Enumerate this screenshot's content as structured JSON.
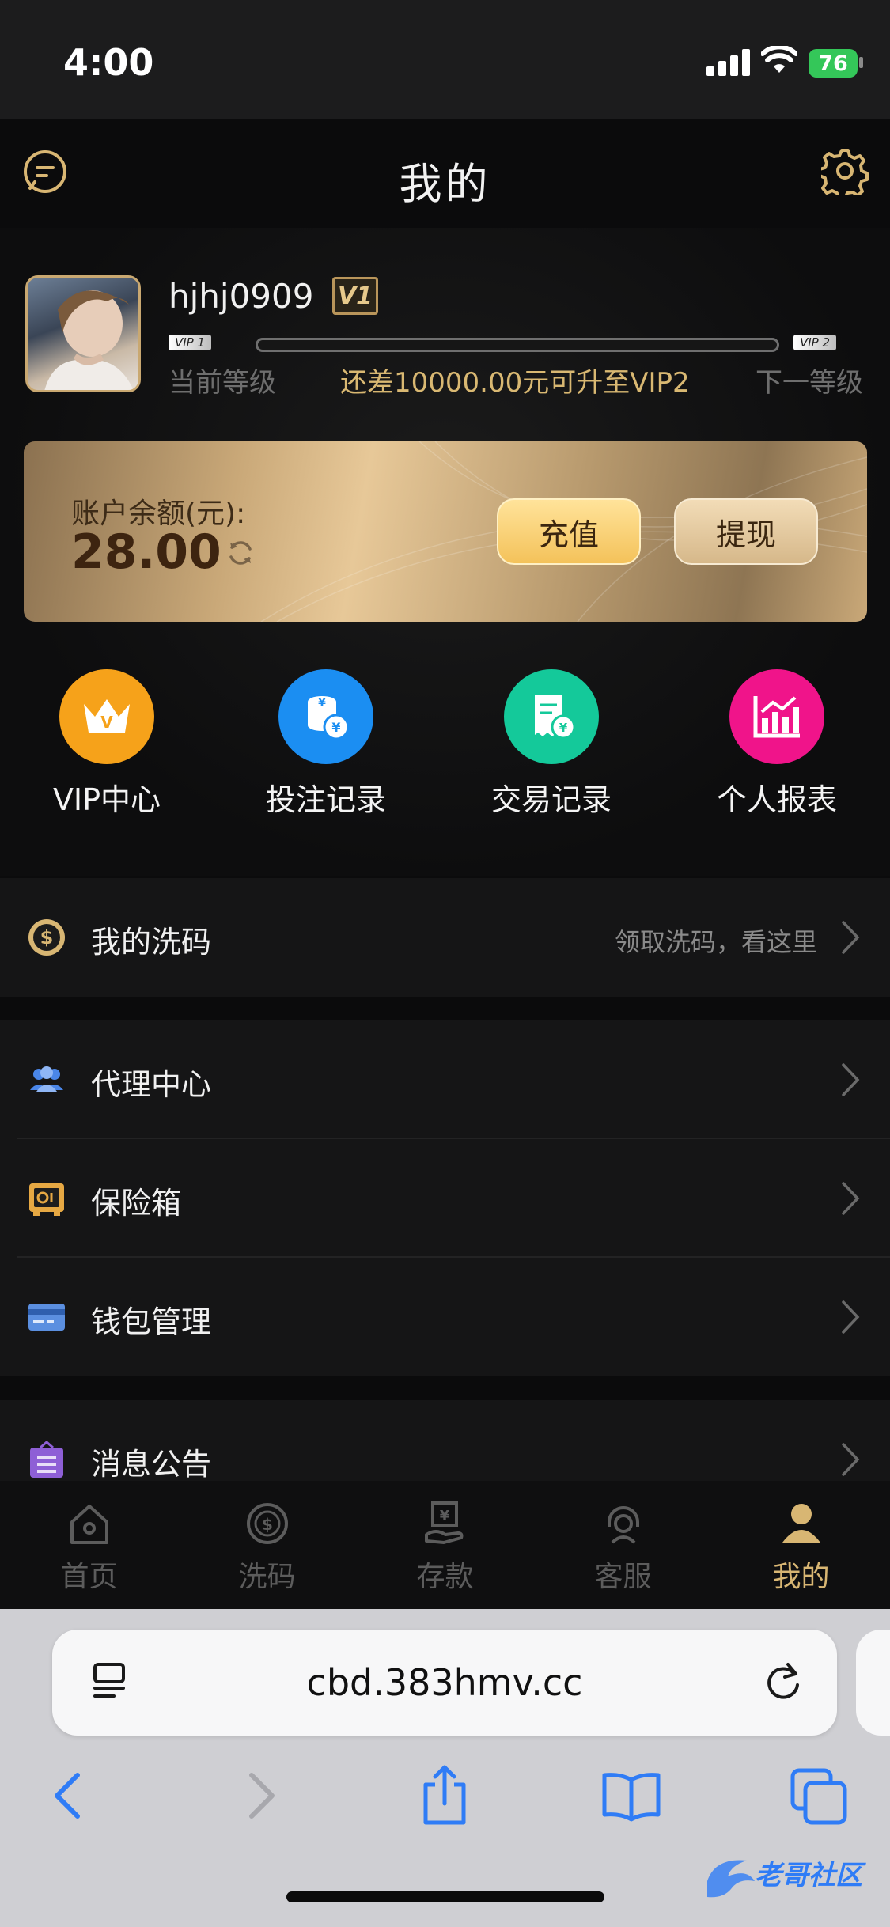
{
  "status_bar": {
    "time": "4:00",
    "battery": "76"
  },
  "header": {
    "title": "我的"
  },
  "profile": {
    "username": "hjhj0909",
    "badge": "V1",
    "current_vip_tag": "VIP 1",
    "next_vip_tag": "VIP 2",
    "current_level_label": "当前等级",
    "next_level_label": "下一等级",
    "upgrade_tip": "还差10000.00元可升至VIP2",
    "progress": 0
  },
  "balance": {
    "label": "账户余额(元):",
    "value": "28.00",
    "recharge_label": "充值",
    "withdraw_label": "提现"
  },
  "shortcuts": [
    {
      "label": "VIP中心",
      "color": "#f6a21a"
    },
    {
      "label": "投注记录",
      "color": "#1b8ef2"
    },
    {
      "label": "交易记录",
      "color": "#14c99a"
    },
    {
      "label": "个人报表",
      "color": "#f0148a"
    }
  ],
  "menu": {
    "wash": {
      "title": "我的洗码",
      "hint": "领取洗码，看这里"
    },
    "agent": {
      "title": "代理中心"
    },
    "safe": {
      "title": "保险箱"
    },
    "wallet": {
      "title": "钱包管理"
    },
    "notice": {
      "title": "消息公告"
    }
  },
  "tabs": [
    {
      "label": "首页",
      "icon": "home-icon"
    },
    {
      "label": "洗码",
      "icon": "chip-icon"
    },
    {
      "label": "存款",
      "icon": "deposit-icon"
    },
    {
      "label": "客服",
      "icon": "service-icon"
    },
    {
      "label": "我的",
      "icon": "user-icon",
      "active": true
    }
  ],
  "browser": {
    "url": "cbd.383hmv.cc"
  },
  "colors": {
    "gold": "#d8b673",
    "background": "#0b0b0c"
  }
}
